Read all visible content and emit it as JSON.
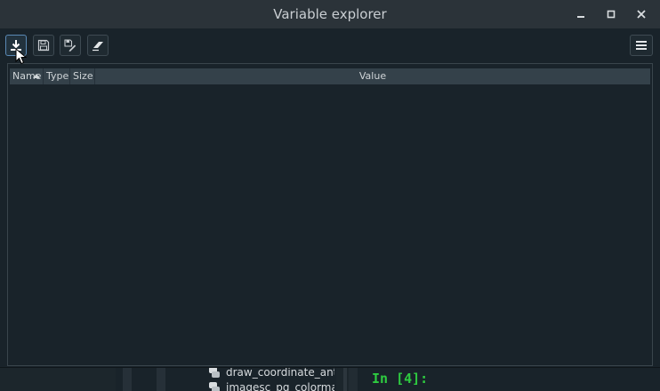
{
  "window": {
    "title": "Variable explorer",
    "controls": {
      "minimize_icon": "minimize-icon",
      "maximize_icon": "maximize-icon",
      "close_icon": "close-icon"
    }
  },
  "toolbar": {
    "buttons": [
      {
        "name": "import-data-button",
        "icon": "download-icon"
      },
      {
        "name": "save-data-button",
        "icon": "floppy-disk-icon"
      },
      {
        "name": "save-data-as-button",
        "icon": "save-as-icon"
      },
      {
        "name": "remove-all-variables-button",
        "icon": "eraser-icon"
      }
    ],
    "options_icon": "hamburger-menu-icon"
  },
  "table": {
    "columns": [
      {
        "key": "name",
        "label": "Name",
        "sorted": "ascending"
      },
      {
        "key": "type",
        "label": "Type"
      },
      {
        "key": "size",
        "label": "Size"
      },
      {
        "key": "value",
        "label": "Value"
      }
    ],
    "rows": []
  },
  "background": {
    "files": [
      "draw_coordinate_ant",
      "imagesc_pg_colormap"
    ],
    "console_prompt": "In [4]:"
  },
  "colors": {
    "window_bg": "#19232a",
    "titlebar_bg": "#2b3339",
    "header_bg": "#34414a",
    "prompt_green": "#2ecc40",
    "active_border": "#5a89b5"
  }
}
